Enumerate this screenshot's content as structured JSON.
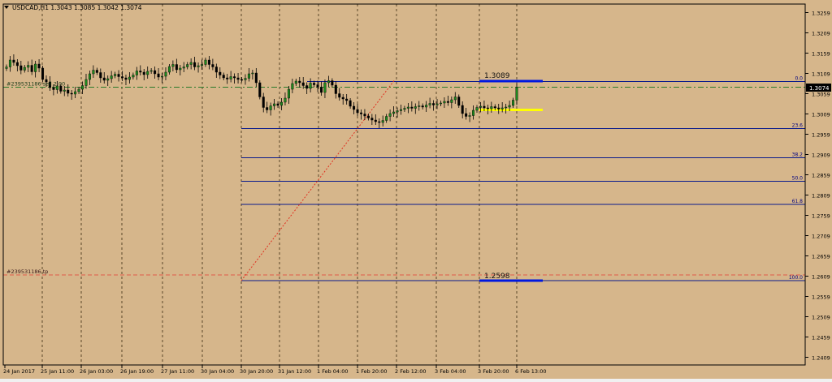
{
  "chart_header": {
    "symbol_line": "USDCAD,H1  1.3043 1.3085 1.3042 1.3074"
  },
  "colors": {
    "background": "#d6b68b",
    "frame": "#000000",
    "grid": "#3a2a10",
    "bull": "#1d8a1d",
    "bear": "#000000",
    "fib_line": "#0a1a8c",
    "fib_label": "#000080",
    "zone_line": "#0018e0",
    "yellow_line": "#ffff00",
    "trend_dotted": "#e03020",
    "order_line": "#2a7a2a",
    "tp_line": "#e05a4a",
    "current_price_bg": "#000000",
    "current_price_fg": "#ffffff",
    "axis_text": "#000000"
  },
  "order_labels": {
    "sell": "#239531186 sell 2.00",
    "tp": "#239531186 tp"
  },
  "current_price_label": "1.3074",
  "zone_labels": {
    "upper": "1.3089",
    "lower": "1.2598"
  },
  "chart_data": {
    "type": "candlestick",
    "symbol": "USDCAD",
    "timeframe": "H1",
    "ohlc_last": {
      "open": 1.3043,
      "high": 1.3085,
      "low": 1.3042,
      "close": 1.3074
    },
    "ylim": [
      1.239,
      1.328
    ],
    "y_ticks": [
      "1.3259",
      "1.3209",
      "1.3159",
      "1.3109",
      "1.3059",
      "1.3009",
      "1.2959",
      "1.2909",
      "1.2859",
      "1.2809",
      "1.2759",
      "1.2709",
      "1.2659",
      "1.2609",
      "1.2559",
      "1.2509",
      "1.2459",
      "1.2409"
    ],
    "x_tick_labels": [
      "24 Jan 2017",
      "25 Jan 11:00",
      "26 Jan 03:00",
      "26 Jan 19:00",
      "27 Jan 11:00",
      "30 Jan 04:00",
      "30 Jan 20:00",
      "31 Jan 12:00",
      "1 Feb 04:00",
      "1 Feb 20:00",
      "2 Feb 12:00",
      "3 Feb 04:00",
      "3 Feb 20:00",
      "6 Feb 13:00"
    ],
    "grid": true,
    "current_price": 1.3074,
    "fibonacci": {
      "start_time": "30 Jan 20:00",
      "levels": [
        {
          "label": "0.0",
          "price": 1.3089
        },
        {
          "label": "23.6",
          "price": 1.2973
        },
        {
          "label": "38.2",
          "price": 1.2901
        },
        {
          "label": "50.0",
          "price": 1.2843
        },
        {
          "label": "61.8",
          "price": 1.2786
        },
        {
          "label": "100.0",
          "price": 1.2598
        }
      ]
    },
    "horizontal_zones": [
      {
        "label": "1.3089",
        "price": 1.309,
        "from": "3 Feb 20:00",
        "to": "6 Feb 13:00",
        "color": "blue"
      },
      {
        "label": "1.2598",
        "price": 1.2598,
        "from": "3 Feb 20:00",
        "to": "6 Feb 13:00",
        "color": "blue"
      },
      {
        "price": 1.3019,
        "from": "3 Feb 20:00",
        "to": "6 Feb 13:00",
        "color": "yellow"
      }
    ],
    "trend_line": {
      "from": {
        "time": "30 Jan 20:00",
        "price": 1.2598
      },
      "to": {
        "time": "1 Feb 20:00",
        "price": 1.3091
      },
      "style": "dotted"
    },
    "orders": [
      {
        "label": "#239531186 sell 2.00",
        "price": 1.3075
      },
      {
        "label": "#239531186 tp",
        "price": 1.2612
      }
    ],
    "close_path": [
      1.3125,
      1.3142,
      1.3136,
      1.3128,
      1.3117,
      1.3124,
      1.3129,
      1.3113,
      1.3132,
      1.3122,
      1.3094,
      1.3088,
      1.3074,
      1.3069,
      1.3078,
      1.3065,
      1.3068,
      1.306,
      1.3058,
      1.3064,
      1.307,
      1.3079,
      1.3094,
      1.3108,
      1.3117,
      1.3111,
      1.3098,
      1.3092,
      1.3096,
      1.3103,
      1.3107,
      1.3101,
      1.3098,
      1.3094,
      1.31,
      1.3105,
      1.3115,
      1.3112,
      1.3106,
      1.3114,
      1.3116,
      1.3108,
      1.31,
      1.3102,
      1.3112,
      1.3126,
      1.3131,
      1.3118,
      1.3122,
      1.3125,
      1.3131,
      1.3136,
      1.3125,
      1.3128,
      1.3131,
      1.3142,
      1.3131,
      1.3125,
      1.3112,
      1.3105,
      1.3098,
      1.3095,
      1.3101,
      1.3098,
      1.3094,
      1.3093,
      1.3097,
      1.3108,
      1.311,
      1.3086,
      1.3051,
      1.3025,
      1.3019,
      1.3029,
      1.3034,
      1.303,
      1.3038,
      1.3048,
      1.307,
      1.3084,
      1.309,
      1.3086,
      1.3079,
      1.3072,
      1.3085,
      1.3081,
      1.3075,
      1.3062,
      1.3086,
      1.3091,
      1.308,
      1.3059,
      1.305,
      1.3046,
      1.3042,
      1.3028,
      1.302,
      1.3012,
      1.3009,
      1.3004,
      1.2999,
      1.2994,
      1.299,
      1.2988,
      1.2993,
      1.3003,
      1.301,
      1.3014,
      1.3017,
      1.302,
      1.3023,
      1.3026,
      1.3023,
      1.3027,
      1.3029,
      1.3026,
      1.3031,
      1.3035,
      1.3031,
      1.3034,
      1.3036,
      1.304,
      1.3037,
      1.3044,
      1.3051,
      1.303,
      1.301,
      1.3003,
      1.3005,
      1.3018,
      1.3025,
      1.3028,
      1.3024,
      1.3022,
      1.3027,
      1.3024,
      1.3021,
      1.3024,
      1.3026,
      1.303,
      1.3043,
      1.3074
    ]
  }
}
